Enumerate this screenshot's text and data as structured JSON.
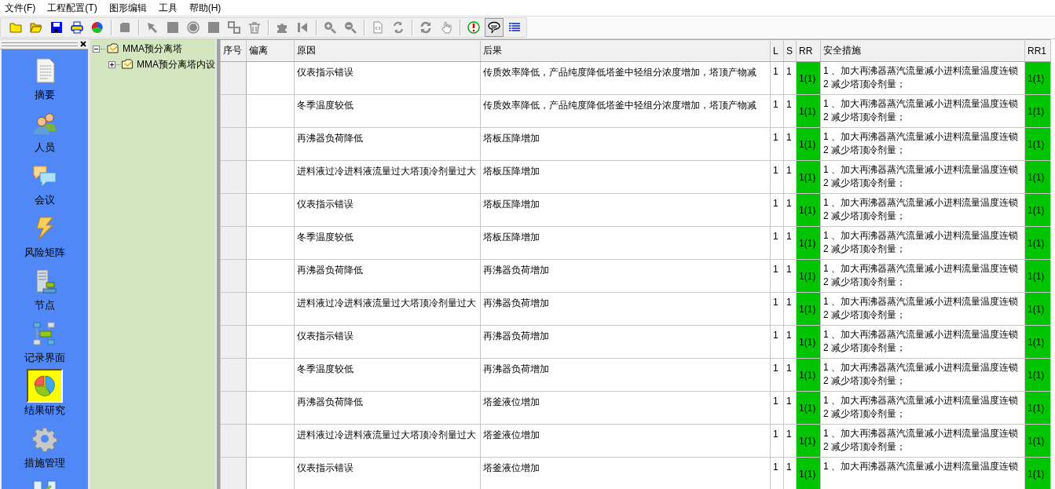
{
  "menu": [
    "文件(F)",
    "工程配置(T)",
    "图形编辑",
    "工具",
    "帮助(H)"
  ],
  "toolbar": {
    "groups": [
      {
        "items": [
          {
            "kind": "folder",
            "disabled": false,
            "pressed": false
          },
          {
            "kind": "folder-open",
            "disabled": false,
            "pressed": false
          },
          {
            "kind": "save",
            "disabled": false,
            "pressed": false
          },
          {
            "kind": "print",
            "disabled": false,
            "pressed": false
          },
          {
            "kind": "pie",
            "disabled": false,
            "pressed": false
          }
        ]
      },
      {
        "items": [
          {
            "kind": "box",
            "disabled": true,
            "pressed": false
          }
        ]
      },
      {
        "items": [
          {
            "kind": "pointer",
            "disabled": true,
            "pressed": false
          },
          {
            "kind": "square",
            "disabled": true,
            "pressed": false
          },
          {
            "kind": "circle",
            "disabled": true,
            "pressed": false
          },
          {
            "kind": "square",
            "disabled": true,
            "pressed": false
          },
          {
            "kind": "connector",
            "disabled": true,
            "pressed": false
          },
          {
            "kind": "trash",
            "disabled": true,
            "pressed": false
          }
        ]
      },
      {
        "items": [
          {
            "kind": "puzzle",
            "disabled": true,
            "pressed": false
          },
          {
            "kind": "skip-back",
            "disabled": true,
            "pressed": false
          }
        ]
      },
      {
        "items": [
          {
            "kind": "zoom-in",
            "disabled": true,
            "pressed": false
          },
          {
            "kind": "zoom-out",
            "disabled": true,
            "pressed": false
          }
        ]
      },
      {
        "items": [
          {
            "kind": "page",
            "disabled": true,
            "pressed": false
          },
          {
            "kind": "refresh",
            "disabled": true,
            "pressed": false
          }
        ]
      },
      {
        "items": [
          {
            "kind": "swap",
            "disabled": true,
            "pressed": false
          },
          {
            "kind": "hand",
            "disabled": true,
            "pressed": false
          }
        ]
      },
      {
        "items": [
          {
            "kind": "alert",
            "disabled": false,
            "pressed": false
          },
          {
            "kind": "speech",
            "disabled": false,
            "pressed": true
          },
          {
            "kind": "list",
            "disabled": false,
            "pressed": false
          }
        ]
      }
    ]
  },
  "nav": {
    "items": [
      {
        "kind": "document",
        "label": "摘要",
        "selected": false
      },
      {
        "kind": "people",
        "label": "人员",
        "selected": false
      },
      {
        "kind": "chat",
        "label": "会议",
        "selected": false
      },
      {
        "kind": "lightning",
        "label": "风险矩阵",
        "selected": false
      },
      {
        "kind": "server",
        "label": "节点",
        "selected": false
      },
      {
        "kind": "diagram",
        "label": "记录界面",
        "selected": false
      },
      {
        "kind": "pie",
        "label": "结果研究",
        "selected": true
      },
      {
        "kind": "gear",
        "label": "措施管理",
        "selected": false
      },
      {
        "kind": "table-chart",
        "selected": false
      }
    ]
  },
  "tree": {
    "nodes": [
      {
        "label": "MMA预分离塔",
        "expanded": true,
        "children": [
          {
            "label": "MMA预分离塔内设",
            "expanded": false
          }
        ]
      }
    ]
  },
  "grid": {
    "columns": [
      "序号",
      "偏离",
      "原因",
      "后果",
      "L",
      "S",
      "RR",
      "安全措施",
      "RR1"
    ],
    "rows": [
      {
        "cause": "仪表指示错误",
        "consequence": "传质效率降低，产品纯度降低塔釜中轻组分浓度增加，塔顶产物减",
        "l": "1",
        "s": "1",
        "rr": "1(1)",
        "color": "#00c400",
        "measure": "1 、加大再沸器蒸汽流量减小进料流量温度连锁\n2 减少塔顶冷剂量；",
        "rr1": "1(1)"
      },
      {
        "cause": "冬季温度较低",
        "consequence": "传质效率降低，产品纯度降低塔釜中轻组分浓度增加，塔顶产物减",
        "l": "1",
        "s": "1",
        "rr": "1(1)",
        "color": "#00c400",
        "measure": "1 、加大再沸器蒸汽流量减小进料流量温度连锁\n2 减少塔顶冷剂量；",
        "rr1": "1(1)"
      },
      {
        "cause": "再沸器负荷降低",
        "consequence": "塔板压降增加",
        "l": "1",
        "s": "1",
        "rr": "1(1)",
        "color": "#00c400",
        "measure": "1 、加大再沸器蒸汽流量减小进料流量温度连锁\n2 减少塔顶冷剂量；",
        "rr1": "1(1)"
      },
      {
        "cause": "进料液过冷进料液流量过大塔顶冷剂量过大",
        "consequence": "塔板压降增加",
        "l": "1",
        "s": "1",
        "rr": "1(1)",
        "color": "#00c400",
        "measure": "1 、加大再沸器蒸汽流量减小进料流量温度连锁\n2 减少塔顶冷剂量；",
        "rr1": "1(1)"
      },
      {
        "cause": "仪表指示错误",
        "consequence": "塔板压降增加",
        "l": "1",
        "s": "1",
        "rr": "1(1)",
        "color": "#00c400",
        "measure": "1 、加大再沸器蒸汽流量减小进料流量温度连锁\n2 减少塔顶冷剂量；",
        "rr1": "1(1)"
      },
      {
        "cause": "冬季温度较低",
        "consequence": "塔板压降增加",
        "l": "1",
        "s": "1",
        "rr": "1(1)",
        "color": "#00c400",
        "measure": "1 、加大再沸器蒸汽流量减小进料流量温度连锁\n2 减少塔顶冷剂量；",
        "rr1": "1(1)"
      },
      {
        "cause": "再沸器负荷降低",
        "consequence": "再沸器负荷增加",
        "l": "1",
        "s": "1",
        "rr": "1(1)",
        "color": "#00c400",
        "measure": "1 、加大再沸器蒸汽流量减小进料流量温度连锁\n2 减少塔顶冷剂量；",
        "rr1": "1(1)"
      },
      {
        "cause": "进料液过冷进料液流量过大塔顶冷剂量过大",
        "consequence": "再沸器负荷增加",
        "l": "1",
        "s": "1",
        "rr": "1(1)",
        "color": "#00c400",
        "measure": "1 、加大再沸器蒸汽流量减小进料流量温度连锁\n2 减少塔顶冷剂量；",
        "rr1": "1(1)"
      },
      {
        "cause": "仪表指示错误",
        "consequence": "再沸器负荷增加",
        "l": "1",
        "s": "1",
        "rr": "1(1)",
        "color": "#00c400",
        "measure": "1 、加大再沸器蒸汽流量减小进料流量温度连锁\n2 减少塔顶冷剂量；",
        "rr1": "1(1)"
      },
      {
        "cause": "冬季温度较低",
        "consequence": "再沸器负荷增加",
        "l": "1",
        "s": "1",
        "rr": "1(1)",
        "color": "#00c400",
        "measure": "1 、加大再沸器蒸汽流量减小进料流量温度连锁\n2 减少塔顶冷剂量；",
        "rr1": "1(1)"
      },
      {
        "cause": "再沸器负荷降低",
        "consequence": "塔釜液位增加",
        "l": "1",
        "s": "1",
        "rr": "1(1)",
        "color": "#00c400",
        "measure": "1 、加大再沸器蒸汽流量减小进料流量温度连锁\n2 减少塔顶冷剂量；",
        "rr1": "1(1)"
      },
      {
        "cause": "进料液过冷进料液流量过大塔顶冷剂量过大",
        "consequence": "塔釜液位增加",
        "l": "1",
        "s": "1",
        "rr": "1(1)",
        "color": "#00c400",
        "measure": "1 、加大再沸器蒸汽流量减小进料流量温度连锁\n2 减少塔顶冷剂量；",
        "rr1": "1(1)"
      },
      {
        "cause": "仪表指示错误",
        "consequence": "塔釜液位增加",
        "l": "1",
        "s": "1",
        "rr": "1(1)",
        "color": "#00c400",
        "measure": "1 、加大再沸器蒸汽流量减小进料流量温度连锁",
        "rr1": "1(1)"
      }
    ]
  }
}
